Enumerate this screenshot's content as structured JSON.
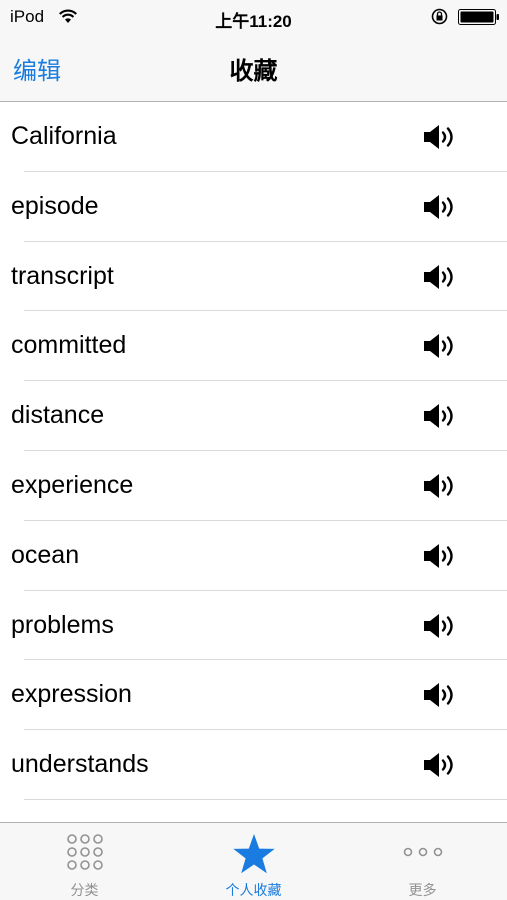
{
  "status_bar": {
    "carrier": "iPod",
    "time": "上午11:20"
  },
  "nav": {
    "edit_label": "编辑",
    "title": "收藏"
  },
  "favorites": [
    {
      "word": "California"
    },
    {
      "word": "episode"
    },
    {
      "word": "transcript"
    },
    {
      "word": "committed"
    },
    {
      "word": "distance"
    },
    {
      "word": "experience"
    },
    {
      "word": "ocean"
    },
    {
      "word": "problems"
    },
    {
      "word": "expression"
    },
    {
      "word": "understands"
    },
    {
      "word": ""
    }
  ],
  "tabs": [
    {
      "label": "分类",
      "icon": "grid-dots-icon",
      "active": false
    },
    {
      "label": "个人收藏",
      "icon": "star-icon",
      "active": true
    },
    {
      "label": "更多",
      "icon": "more-dots-icon",
      "active": false
    }
  ],
  "colors": {
    "accent": "#1a7ce0",
    "bar_background": "#f7f7f7",
    "inactive_tab": "#929292",
    "separator": "#d9d9d9"
  }
}
